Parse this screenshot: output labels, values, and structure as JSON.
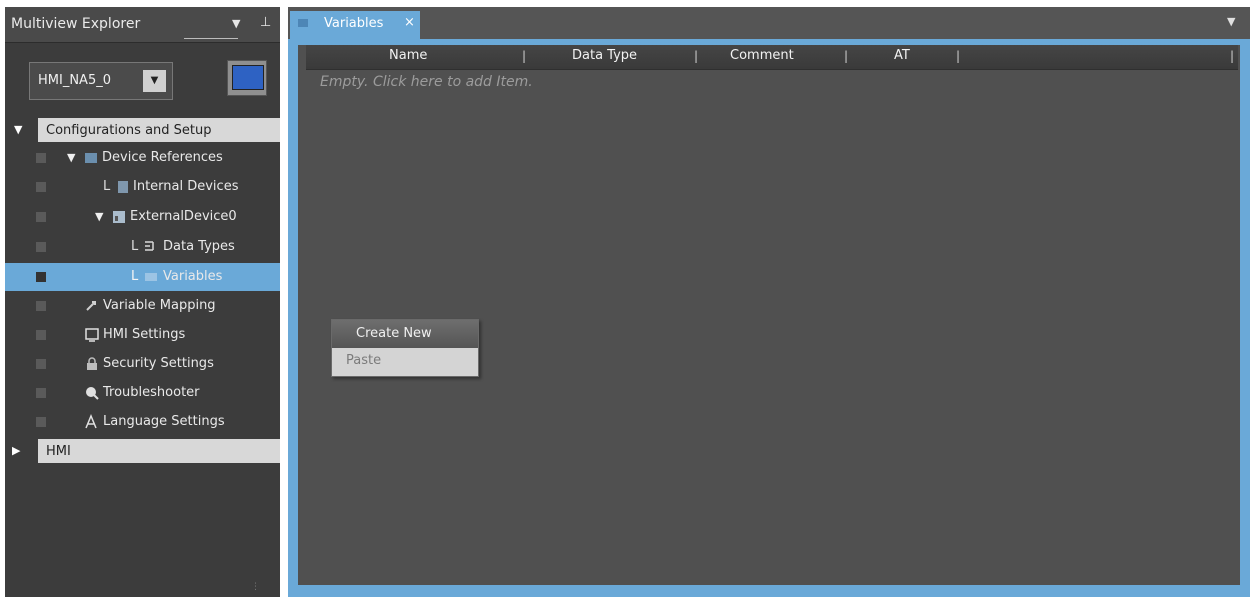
{
  "explorer": {
    "title": "Multiview Explorer",
    "device_select": "HMI_NA5_0",
    "tree": {
      "config_header": "Configurations and Setup",
      "device_refs": "Device References",
      "internal": "Internal Devices",
      "external": "ExternalDevice0",
      "data_types": "Data Types",
      "variables": "Variables",
      "var_mapping": "Variable Mapping",
      "hmi_settings": "HMI Settings",
      "security": "Security Settings",
      "troubleshooter": "Troubleshooter",
      "language": "Language Settings",
      "hmi_header": "HMI"
    }
  },
  "editor": {
    "tab": {
      "label": "Variables",
      "close": "×"
    },
    "columns": [
      "Name",
      "Data Type",
      "Comment",
      "AT"
    ],
    "empty_message": "Empty. Click here to add Item.",
    "context_menu": {
      "create_new": "Create New",
      "paste": "Paste"
    }
  },
  "colors": {
    "accent": "#6aa9d8",
    "panel": "#3c3c3c",
    "editor": "#505050"
  }
}
